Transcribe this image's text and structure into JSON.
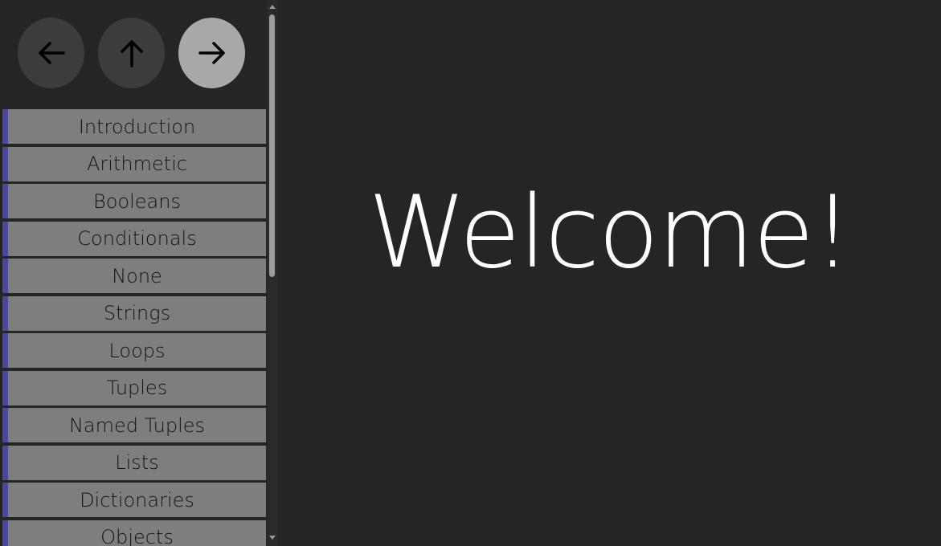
{
  "nav": {
    "back_icon": "arrow-left-icon",
    "up_icon": "arrow-up-icon",
    "forward_icon": "arrow-right-icon"
  },
  "sidebar": {
    "items": [
      {
        "label": "Introduction"
      },
      {
        "label": "Arithmetic"
      },
      {
        "label": "Booleans"
      },
      {
        "label": "Conditionals"
      },
      {
        "label": "None"
      },
      {
        "label": "Strings"
      },
      {
        "label": "Loops"
      },
      {
        "label": "Tuples"
      },
      {
        "label": "Named Tuples"
      },
      {
        "label": "Lists"
      },
      {
        "label": "Dictionaries"
      },
      {
        "label": "Objects"
      }
    ]
  },
  "main": {
    "heading": "Welcome!"
  },
  "colors": {
    "background": "#252525",
    "topic_bg": "#7e7e7e",
    "topic_accent": "#4a46a8",
    "nav_active": "#a9a9a9",
    "nav_inactive": "#3c3c3c"
  }
}
